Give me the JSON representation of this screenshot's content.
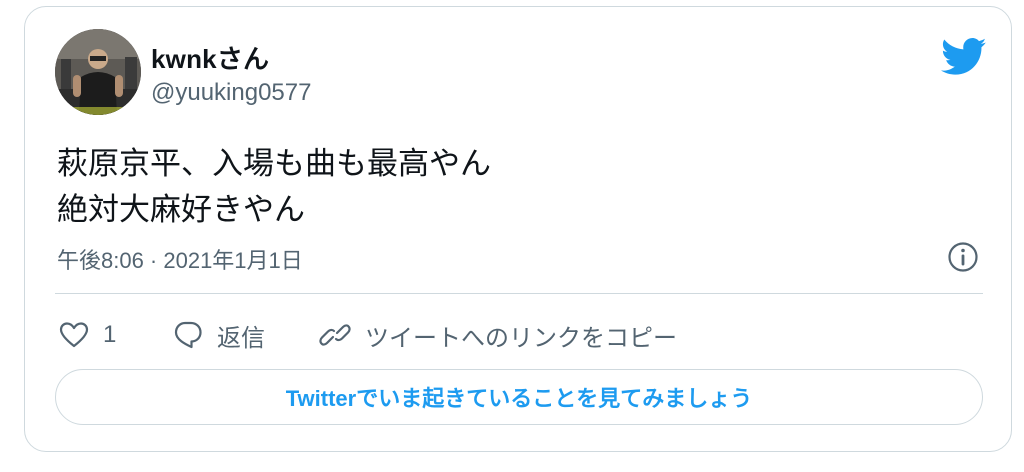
{
  "user": {
    "display_name": "kwnkさん",
    "handle": "@yuuking0577"
  },
  "tweet": {
    "lines": [
      "萩原京平、入場も曲も最高やん",
      "絶対大麻好きやん"
    ],
    "timestamp": "午後8:06 · 2021年1月1日"
  },
  "actions": {
    "like_count": "1",
    "reply_label": "返信",
    "copy_link_label": "ツイートへのリンクをコピー"
  },
  "cta": {
    "label": "Twitterでいま起きていることを見てみましょう"
  },
  "colors": {
    "brand": "#1d9bf0",
    "secondary_text": "#536471",
    "border": "#cfd9de"
  }
}
